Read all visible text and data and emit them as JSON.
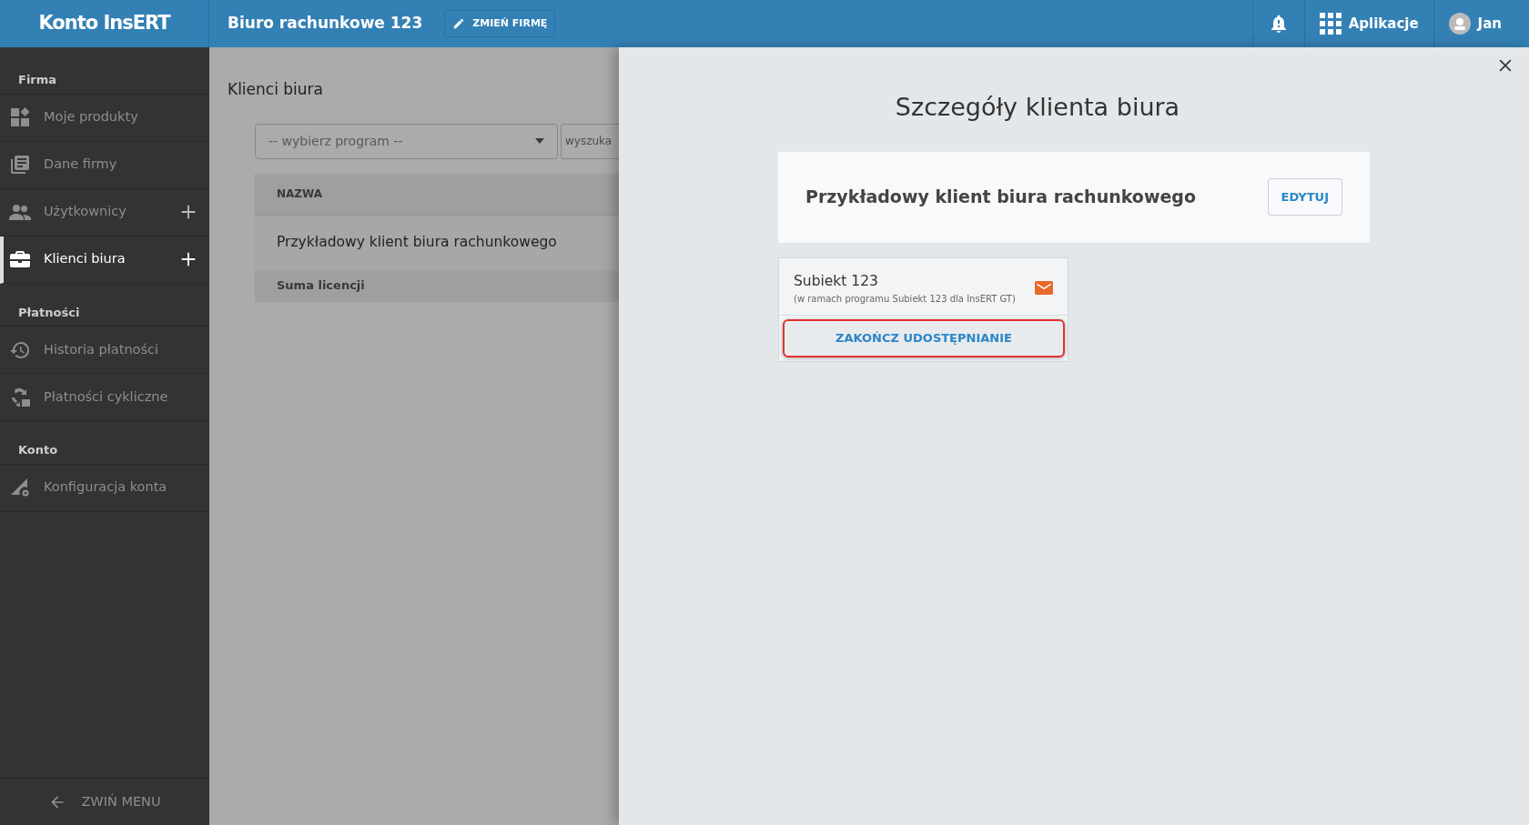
{
  "header": {
    "brand": "Konto InsERT",
    "company": "Biuro rachunkowe 123",
    "change_button": "ZMIEŃ FIRMĘ",
    "apps_label": "Aplikacje",
    "user_name": "Jan"
  },
  "sidebar": {
    "sections": [
      {
        "label": "Firma",
        "items": [
          {
            "label": "Moje produkty",
            "selected": false,
            "can_add": false
          },
          {
            "label": "Dane firmy",
            "selected": false,
            "can_add": false
          },
          {
            "label": "Użytkownicy",
            "selected": false,
            "can_add": true
          },
          {
            "label": "Klienci biura",
            "selected": true,
            "can_add": true
          }
        ]
      },
      {
        "label": "Płatności",
        "items": [
          {
            "label": "Historia płatności",
            "selected": false,
            "can_add": false
          },
          {
            "label": "Płatności cykliczne",
            "selected": false,
            "can_add": false
          }
        ]
      },
      {
        "label": "Konto",
        "items": [
          {
            "label": "Konfiguracja konta",
            "selected": false,
            "can_add": false
          }
        ]
      }
    ],
    "collapse_label": "ZWIŃ MENU"
  },
  "main": {
    "title": "Klienci biura",
    "program_select": {
      "placeholder": "-- wybierz program --"
    },
    "search": {
      "placeholder": "wyszuka"
    },
    "table": {
      "columns": [
        "NAZWA"
      ],
      "rows": [
        [
          "Przykładowy klient biura rachunkowego"
        ]
      ],
      "footer": "Suma licencji"
    }
  },
  "detail_panel": {
    "title": "Szczegóły klienta biura",
    "client_name": "Przykładowy klient biura rachunkowego",
    "edit_button": "EDYTUJ",
    "products": [
      {
        "name": "Subiekt 123",
        "note": "(w ramach programu Subiekt 123 dla InsERT GT)",
        "action": "ZAKOŃCZ UDOSTĘPNIANIE",
        "highlighted": true
      }
    ]
  }
}
